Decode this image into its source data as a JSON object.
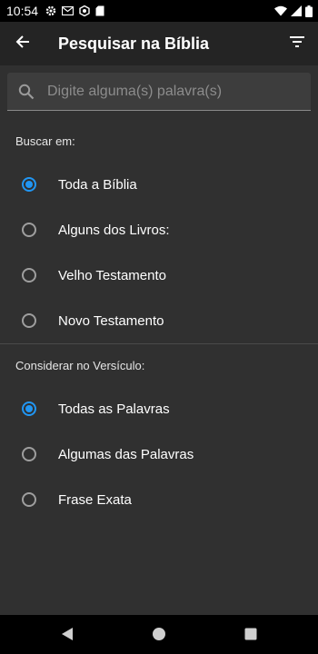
{
  "status_bar": {
    "time": "10:54",
    "left_icons": [
      "settings-icon",
      "gmail-icon",
      "app-icon",
      "sd-card-icon"
    ],
    "right_icons": [
      "wifi-icon",
      "signal-icon",
      "battery-icon"
    ]
  },
  "app_bar": {
    "title": "Pesquisar na Bíblia",
    "back_icon": "arrow-back-icon",
    "filter_icon": "filter-icon"
  },
  "search": {
    "placeholder": "Digite alguma(s) palavra(s)",
    "value": ""
  },
  "scope_section": {
    "label": "Buscar em:",
    "options": [
      {
        "label": "Toda a Bíblia",
        "checked": true
      },
      {
        "label": "Alguns dos Livros:",
        "checked": false
      },
      {
        "label": "Velho Testamento",
        "checked": false
      },
      {
        "label": "Novo Testamento",
        "checked": false
      }
    ]
  },
  "match_section": {
    "label": "Considerar no Versículo:",
    "options": [
      {
        "label": "Todas as Palavras",
        "checked": true
      },
      {
        "label": "Algumas das Palavras",
        "checked": false
      },
      {
        "label": "Frase Exata",
        "checked": false
      }
    ]
  },
  "nav_bar": {
    "buttons": [
      "back-triangle-icon",
      "home-circle-icon",
      "recents-square-icon"
    ]
  },
  "colors": {
    "background": "#303030",
    "app_bar": "#242424",
    "accent": "#2196f3"
  }
}
